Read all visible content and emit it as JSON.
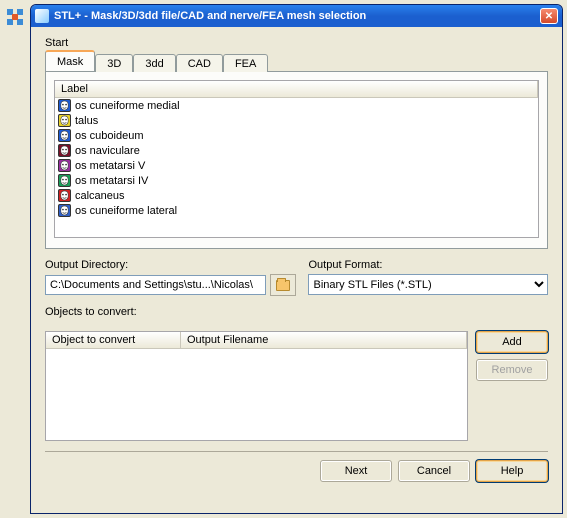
{
  "window": {
    "title": "STL+ - Mask/3D/3dd file/CAD and nerve/FEA mesh selection",
    "start_label": "Start"
  },
  "tabs": [
    {
      "label": "Mask",
      "active": true
    },
    {
      "label": "3D",
      "active": false
    },
    {
      "label": "3dd",
      "active": false
    },
    {
      "label": "CAD",
      "active": false
    },
    {
      "label": "FEA",
      "active": false
    }
  ],
  "mask_list": {
    "header": "Label",
    "items": [
      {
        "name": "os cuneiforme medial",
        "color": "#1c5bd6"
      },
      {
        "name": "talus",
        "color": "#e8d22b"
      },
      {
        "name": "os cuboideum",
        "color": "#1c5bd6"
      },
      {
        "name": "os naviculare",
        "color": "#7a1028"
      },
      {
        "name": "os metatarsi V",
        "color": "#9a2ea0"
      },
      {
        "name": "os metatarsi IV",
        "color": "#1aa05a"
      },
      {
        "name": "calcaneus",
        "color": "#d22020"
      },
      {
        "name": "os cuneiforme lateral",
        "color": "#3060c8"
      }
    ]
  },
  "output_dir": {
    "label": "Output Directory:",
    "value": "C:\\Documents and Settings\\stu...\\Nicolas\\"
  },
  "output_format": {
    "label": "Output Format:",
    "selected": "Binary STL Files (*.STL)",
    "options": [
      "Binary STL Files (*.STL)"
    ]
  },
  "objects": {
    "label": "Objects to convert:",
    "col1": "Object to convert",
    "col2": "Output Filename"
  },
  "buttons": {
    "add": "Add",
    "remove": "Remove",
    "next": "Next",
    "cancel": "Cancel",
    "help": "Help"
  }
}
